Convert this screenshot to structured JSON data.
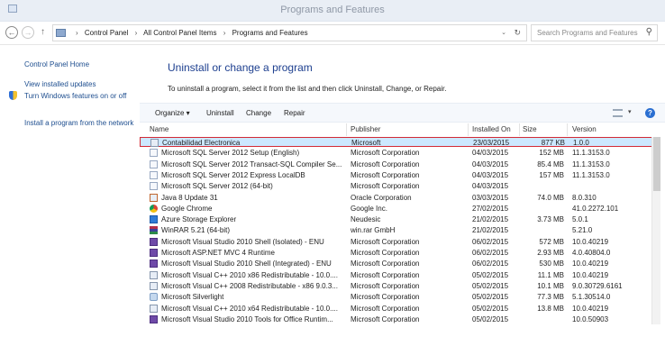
{
  "window": {
    "title": "Programs and Features"
  },
  "address": {
    "crumbs": [
      "Control Panel",
      "All Control Panel Items",
      "Programs and Features"
    ],
    "search_placeholder": "Search Programs and Features"
  },
  "left_pane": {
    "links": [
      "Control Panel Home",
      "View installed updates",
      "Turn Windows features on or off",
      "Install a program from the network"
    ]
  },
  "main": {
    "heading": "Uninstall or change a program",
    "subtext": "To uninstall a program, select it from the list and then click Uninstall, Change, or Repair."
  },
  "toolbar": {
    "organize": "Organize ▾",
    "uninstall": "Uninstall",
    "change": "Change",
    "repair": "Repair"
  },
  "columns": [
    "Name",
    "Publisher",
    "Installed On",
    "Size",
    "Version"
  ],
  "programs": [
    {
      "name": "Contabilidad Electronica",
      "publisher": "Microsoft",
      "installed": "23/03/2015",
      "size": "877 KB",
      "version": "1.0.0",
      "icon": "box-icon"
    },
    {
      "name": "Microsoft SQL Server 2012 Setup (English)",
      "publisher": "Microsoft Corporation",
      "installed": "04/03/2015",
      "size": "152 MB",
      "version": "11.1.3153.0",
      "icon": "doc-icon"
    },
    {
      "name": "Microsoft SQL Server 2012 Transact-SQL Compiler Se...",
      "publisher": "Microsoft Corporation",
      "installed": "04/03/2015",
      "size": "85.4 MB",
      "version": "11.1.3153.0",
      "icon": "doc-icon"
    },
    {
      "name": "Microsoft SQL Server 2012 Express LocalDB",
      "publisher": "Microsoft Corporation",
      "installed": "04/03/2015",
      "size": "157 MB",
      "version": "11.1.3153.0",
      "icon": "doc-icon"
    },
    {
      "name": "Microsoft SQL Server 2012 (64-bit)",
      "publisher": "Microsoft Corporation",
      "installed": "04/03/2015",
      "size": "",
      "version": "",
      "icon": "doc-icon"
    },
    {
      "name": "Java 8 Update 31",
      "publisher": "Oracle Corporation",
      "installed": "03/03/2015",
      "size": "74.0 MB",
      "version": "8.0.310",
      "icon": "java-icon"
    },
    {
      "name": "Google Chrome",
      "publisher": "Google Inc.",
      "installed": "27/02/2015",
      "size": "",
      "version": "41.0.2272.101",
      "icon": "chrome-icon"
    },
    {
      "name": "Azure Storage Explorer",
      "publisher": "Neudesic",
      "installed": "21/02/2015",
      "size": "3.73 MB",
      "version": "5.0.1",
      "icon": "azure-icon"
    },
    {
      "name": "WinRAR 5.21 (64-bit)",
      "publisher": "win.rar GmbH",
      "installed": "21/02/2015",
      "size": "",
      "version": "5.21.0",
      "icon": "winrar-icon"
    },
    {
      "name": "Microsoft Visual Studio 2010 Shell (Isolated) - ENU",
      "publisher": "Microsoft Corporation",
      "installed": "06/02/2015",
      "size": "572 MB",
      "version": "10.0.40219",
      "icon": "vs-icon"
    },
    {
      "name": "Microsoft ASP.NET MVC 4 Runtime",
      "publisher": "Microsoft Corporation",
      "installed": "06/02/2015",
      "size": "2.93 MB",
      "version": "4.0.40804.0",
      "icon": "vs-icon"
    },
    {
      "name": "Microsoft Visual Studio 2010 Shell (Integrated) - ENU",
      "publisher": "Microsoft Corporation",
      "installed": "06/02/2015",
      "size": "530 MB",
      "version": "10.0.40219",
      "icon": "vs-icon"
    },
    {
      "name": "Microsoft Visual C++ 2010  x86 Redistributable - 10.0....",
      "publisher": "Microsoft Corporation",
      "installed": "05/02/2015",
      "size": "11.1 MB",
      "version": "10.0.40219",
      "icon": "box-icon"
    },
    {
      "name": "Microsoft Visual C++ 2008 Redistributable - x86 9.0.3...",
      "publisher": "Microsoft Corporation",
      "installed": "05/02/2015",
      "size": "10.1 MB",
      "version": "9.0.30729.6161",
      "icon": "box-icon"
    },
    {
      "name": "Microsoft Silverlight",
      "publisher": "Microsoft Corporation",
      "installed": "05/02/2015",
      "size": "77.3 MB",
      "version": "5.1.30514.0",
      "icon": "silverlight-icon"
    },
    {
      "name": "Microsoft Visual C++ 2010  x64 Redistributable - 10.0....",
      "publisher": "Microsoft Corporation",
      "installed": "05/02/2015",
      "size": "13.8 MB",
      "version": "10.0.40219",
      "icon": "box-icon"
    },
    {
      "name": "Microsoft Visual Studio 2010 Tools for Office Runtim...",
      "publisher": "Microsoft Corporation",
      "installed": "05/02/2015",
      "size": "",
      "version": "10.0.50903",
      "icon": "vs-icon"
    }
  ],
  "selected_index": 0,
  "colors": {
    "selection": "#cce8ff",
    "highlight_border": "#d22b36",
    "link": "#1e4e8f",
    "heading": "#1d3f8f"
  }
}
